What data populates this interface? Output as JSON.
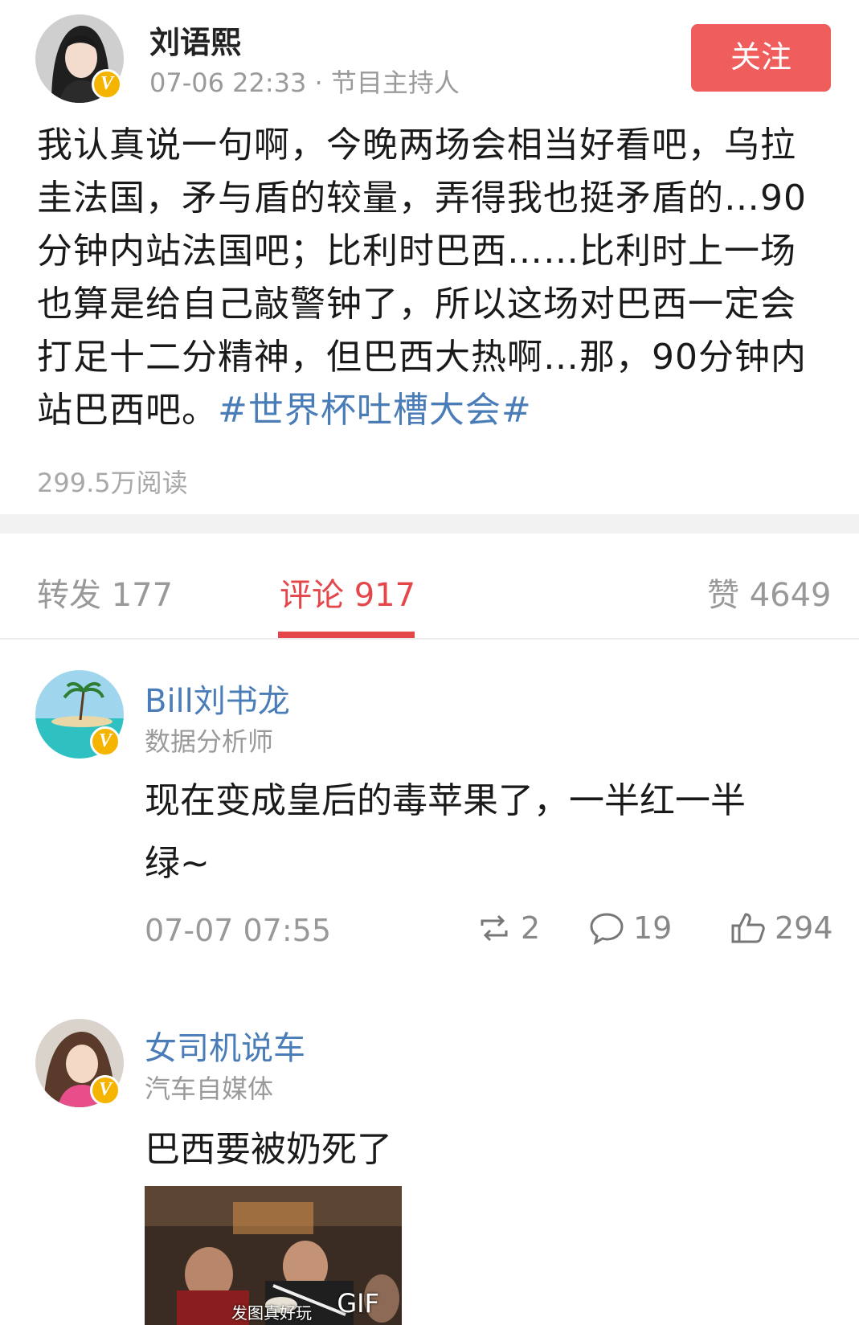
{
  "post": {
    "author": "刘语熙",
    "time": "07-06 22:33",
    "separator": "·",
    "role": "节目主持人",
    "follow_label": "关注",
    "text": "我认真说一句啊，今晚两场会相当好看吧，乌拉圭法国，矛与盾的较量，弄得我也挺矛盾的…90分钟内站法国吧；比利时巴西……比利时上一场也算是给自己敲警钟了，所以这场对巴西一定会打足十二分精神，但巴西大热啊…那，90分钟内站巴西吧。",
    "hashtag": "#世界杯吐槽大会#",
    "reads": "299.5万阅读"
  },
  "tabs": {
    "repost": "转发 177",
    "comments": "评论 917",
    "likes": "赞 4649"
  },
  "comments": [
    {
      "author": "Bill刘书龙",
      "role": "数据分析师",
      "text_line1": "现在变成皇后的毒苹果了，一半红一半",
      "text_line2": "绿~",
      "time": "07-07 07:55",
      "reposts": "2",
      "replies": "19",
      "likes": "294"
    },
    {
      "author": "女司机说车",
      "role": "汽车自媒体",
      "text": "巴西要被奶死了",
      "gif_label": "GIF",
      "gif_caption": "发图真好玩"
    }
  ],
  "badge_letter": "V",
  "icons": {
    "verified": "verified-v-badge",
    "repost": "repost-icon",
    "comment": "comment-bubble-icon",
    "like": "thumbs-up-icon"
  },
  "colors": {
    "accent_red": "#e5464a",
    "follow_button": "#f05d5d",
    "link_blue": "#4a7db8",
    "verified_gold": "#f5b400"
  }
}
